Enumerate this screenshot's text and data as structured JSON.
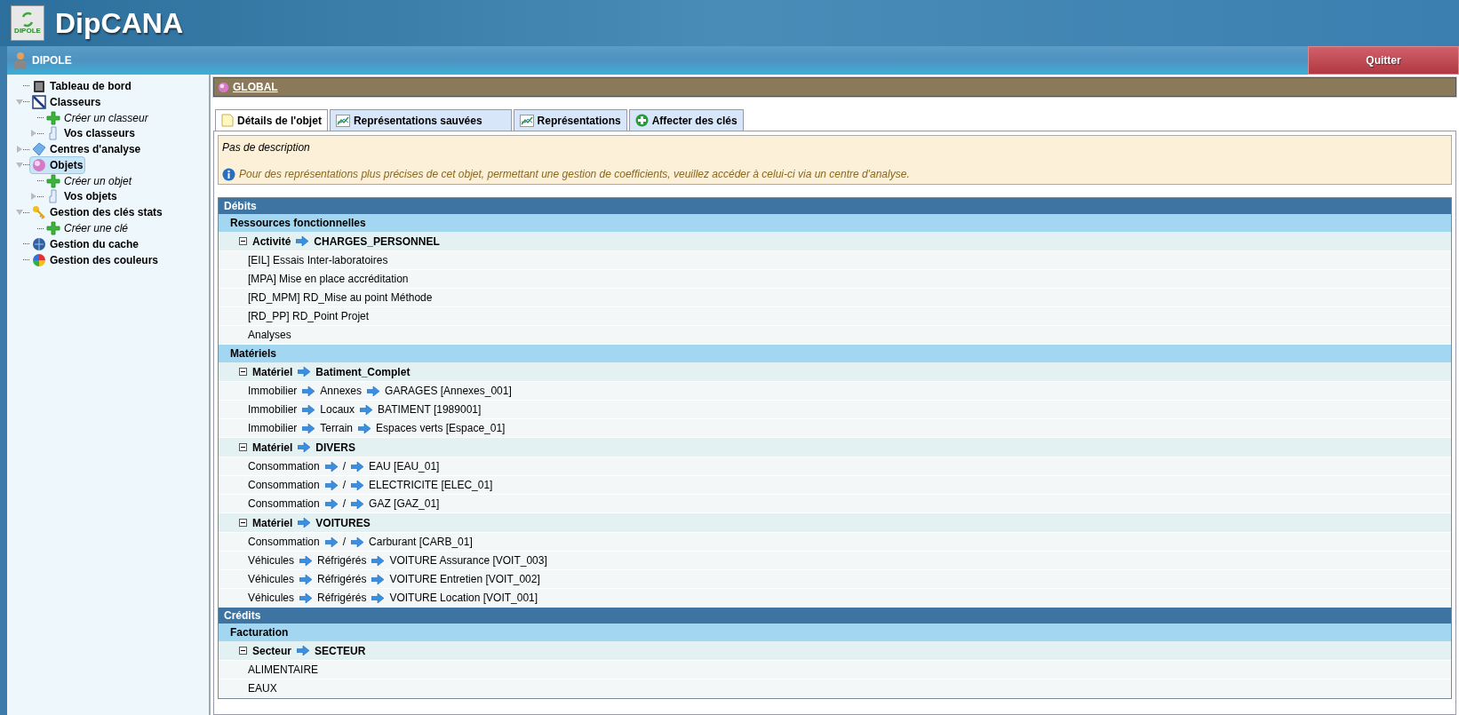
{
  "header": {
    "logo_caption": "DIPOLE",
    "app_title": "DipCANA"
  },
  "toolbar": {
    "user": "DIPOLE",
    "quit_button": "Quitter"
  },
  "sidebar": {
    "items": [
      {
        "label": "Tableau de bord",
        "kind": "dashboard",
        "selected": false
      },
      {
        "label": "Classeurs",
        "kind": "binder",
        "selected": false,
        "expanded": true,
        "children": [
          {
            "label": "Créer un classeur",
            "kind": "create",
            "selected": false
          },
          {
            "label": "Vos classeurs",
            "kind": "folder",
            "selected": false,
            "expanded": false
          }
        ]
      },
      {
        "label": "Centres d'analyse",
        "kind": "center",
        "selected": false,
        "expanded": false
      },
      {
        "label": "Objets",
        "kind": "object",
        "selected": true,
        "expanded": true,
        "children": [
          {
            "label": "Créer un objet",
            "kind": "create",
            "selected": false
          },
          {
            "label": "Vos objets",
            "kind": "folder",
            "selected": false,
            "expanded": false
          }
        ]
      },
      {
        "label": "Gestion des clés stats",
        "kind": "key",
        "selected": false,
        "expanded": true,
        "children": [
          {
            "label": "Créer une clé",
            "kind": "create",
            "selected": false
          }
        ]
      },
      {
        "label": "Gestion du cache",
        "kind": "cache",
        "selected": false
      },
      {
        "label": "Gestion des couleurs",
        "kind": "colors",
        "selected": false
      }
    ]
  },
  "panel": {
    "title": "GLOBAL"
  },
  "tabs": [
    {
      "label": "Détails de l'objet",
      "kind": "note",
      "selected": true
    },
    {
      "label": "Représentations sauvées",
      "kind": "chart",
      "selected": false
    },
    {
      "label": "Représentations",
      "kind": "chart",
      "selected": false
    },
    {
      "label": "Affecter des clés",
      "kind": "add",
      "selected": false
    }
  ],
  "description": {
    "text": "Pas de description",
    "info": "Pour des représentations plus précises de cet objet, permettant une gestion de coefficients, veuillez accéder à celui-ci via un centre d'analyse."
  },
  "sections": [
    {
      "title": "Débits",
      "groups": [
        {
          "title": "Ressources fonctionnelles",
          "subgroups": [
            {
              "parts": [
                "Activité",
                "CHARGES_PERSONNEL"
              ],
              "expanded": true,
              "items": [
                [
                  "[EIL] Essais Inter-laboratoires"
                ],
                [
                  "[MPA] Mise en place accréditation"
                ],
                [
                  "[RD_MPM] RD_Mise au point Méthode"
                ],
                [
                  "[RD_PP] RD_Point Projet"
                ],
                [
                  "Analyses"
                ]
              ]
            }
          ]
        },
        {
          "title": "Matériels",
          "subgroups": [
            {
              "parts": [
                "Matériel",
                "Batiment_Complet"
              ],
              "expanded": true,
              "items": [
                [
                  "Immobilier",
                  "Annexes",
                  "GARAGES [Annexes_001]"
                ],
                [
                  "Immobilier",
                  "Locaux",
                  "BATIMENT [1989001]"
                ],
                [
                  "Immobilier",
                  "Terrain",
                  "Espaces verts [Espace_01]"
                ]
              ]
            },
            {
              "parts": [
                "Matériel",
                "DIVERS"
              ],
              "expanded": true,
              "items": [
                [
                  "Consommation",
                  "/",
                  "EAU [EAU_01]"
                ],
                [
                  "Consommation",
                  "/",
                  "ELECTRICITE [ELEC_01]"
                ],
                [
                  "Consommation",
                  "/",
                  "GAZ [GAZ_01]"
                ]
              ]
            },
            {
              "parts": [
                "Matériel",
                "VOITURES"
              ],
              "expanded": true,
              "items": [
                [
                  "Consommation",
                  "/",
                  "Carburant [CARB_01]"
                ],
                [
                  "Véhicules",
                  "Réfrigérés",
                  "VOITURE Assurance [VOIT_003]"
                ],
                [
                  "Véhicules",
                  "Réfrigérés",
                  "VOITURE Entretien [VOIT_002]"
                ],
                [
                  "Véhicules",
                  "Réfrigérés",
                  "VOITURE Location [VOIT_001]"
                ]
              ]
            }
          ]
        }
      ]
    },
    {
      "title": "Crédits",
      "groups": [
        {
          "title": "Facturation",
          "subgroups": [
            {
              "parts": [
                "Secteur",
                "SECTEUR"
              ],
              "expanded": true,
              "items": [
                [
                  "ALIMENTAIRE"
                ],
                [
                  "EAUX"
                ]
              ]
            }
          ]
        }
      ]
    }
  ]
}
